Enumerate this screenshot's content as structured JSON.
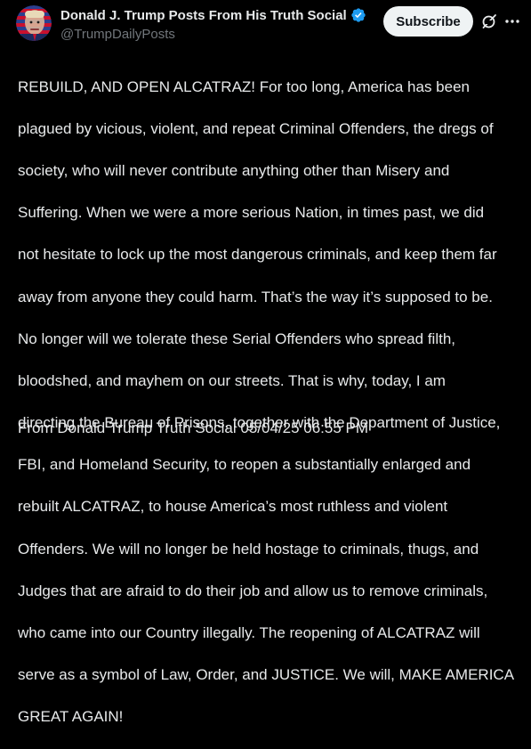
{
  "account": {
    "display_name": "Donald J. Trump Posts From His Truth Social",
    "handle": "@TrumpDailyPosts",
    "verified": true,
    "verified_color": "#1d9bf0"
  },
  "actions": {
    "subscribe_label": "Subscribe",
    "grok_icon": "grok-slash-icon",
    "more_icon": "more-horizontal-icon"
  },
  "post": {
    "lines": [
      "REBUILD, AND OPEN ALCATRAZ! For too long, America has been",
      "plagued by vicious, violent, and repeat Criminal Offenders, the dregs of",
      "society, who will never contribute anything other than Misery and",
      "Suffering. When we were a more serious Nation, in times past, we did",
      "not hesitate to lock up the most dangerous criminals, and keep them far",
      "away from anyone they could harm. That’s the way it’s supposed to be.",
      "No longer will we tolerate these Serial Offenders who spread filth,",
      "bloodshed, and mayhem on our streets. That is why, today, I am",
      "directing the Bureau of Prisons, together with the Department of Justice,",
      "FBI, and Homeland Security, to reopen a substantially enlarged and",
      "rebuilt ALCATRAZ, to house America’s most ruthless and violent",
      "Offenders. We will no longer be held hostage to criminals, thugs, and",
      "Judges that are afraid to do their job and allow us to remove criminals,",
      "who came into our Country illegally. The reopening of ALCATRAZ will",
      "serve as a symbol of Law, Order, and JUSTICE. We will, MAKE AMERICA",
      "GREAT AGAIN!"
    ],
    "footer": "From Donald Trump Truth Social 05/04/25 06:55 PM"
  },
  "theme": {
    "background": "#000000",
    "text": "#e7e9ea",
    "secondary_text": "#71767b",
    "button_bg": "#eff3f4"
  }
}
